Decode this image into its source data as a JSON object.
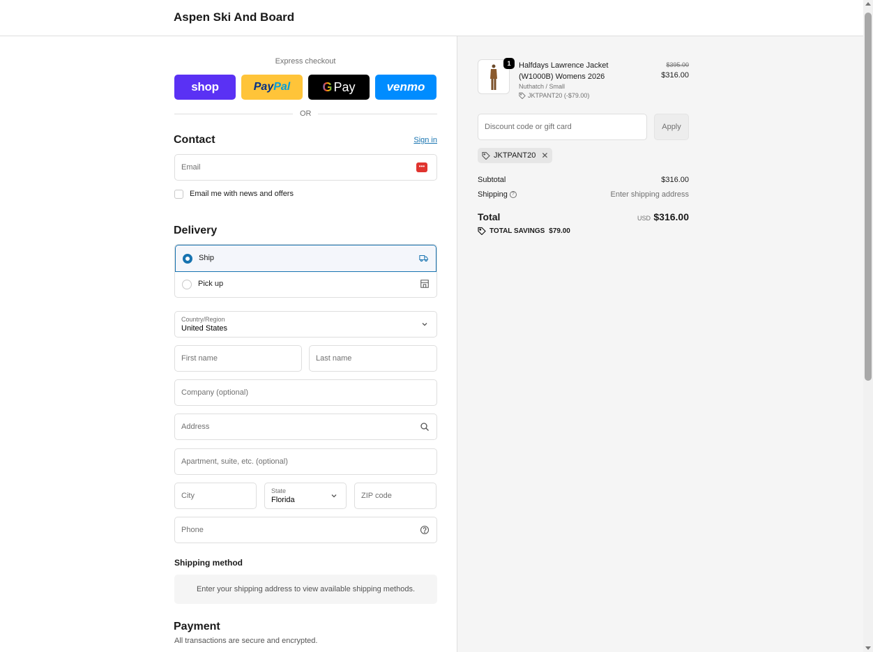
{
  "header": {
    "brand": "Aspen Ski And Board"
  },
  "express": {
    "label": "Express checkout",
    "shop": "shop",
    "paypal_a": "Pay",
    "paypal_b": "Pal",
    "gpay_g": "G",
    "gpay_text": "Pay",
    "venmo": "venmo",
    "or": "OR"
  },
  "contact": {
    "title": "Contact",
    "sign_in": "Sign in",
    "email_placeholder": "Email",
    "news_label": "Email me with news and offers"
  },
  "delivery": {
    "title": "Delivery",
    "options": [
      {
        "label": "Ship",
        "selected": true,
        "icon": "truck-icon"
      },
      {
        "label": "Pick up",
        "selected": false,
        "icon": "store-icon"
      }
    ],
    "country_label": "Country/Region",
    "country_value": "United States",
    "first_name": "First name",
    "last_name": "Last name",
    "company": "Company (optional)",
    "address": "Address",
    "apartment": "Apartment, suite, etc. (optional)",
    "city": "City",
    "state_label": "State",
    "state_value": "Florida",
    "zip": "ZIP code",
    "phone": "Phone"
  },
  "shipping_method": {
    "title": "Shipping method",
    "message": "Enter your shipping address to view available shipping methods."
  },
  "payment": {
    "title": "Payment",
    "subtitle": "All transactions are secure and encrypted."
  },
  "order": {
    "item": {
      "quantity": "1",
      "name": "Halfdays Lawrence Jacket (W1000B) Womens 2026",
      "variant": "Nuthatch / Small",
      "discount": "JKTPANT20 (-$79.00)",
      "original_price": "$395.00",
      "price": "$316.00"
    },
    "discount_placeholder": "Discount code or gift card",
    "apply": "Apply",
    "applied_code": "JKTPANT20",
    "subtotal_label": "Subtotal",
    "subtotal_value": "$316.00",
    "shipping_label": "Shipping",
    "shipping_value": "Enter shipping address",
    "total_label": "Total",
    "currency": "USD",
    "total_value": "$316.00",
    "savings_label": "TOTAL SAVINGS",
    "savings_value": "$79.00"
  },
  "colors": {
    "accent": "#1773b0",
    "shop_pay": "#5a31f4",
    "paypal": "#ffc439",
    "venmo": "#008cff"
  }
}
